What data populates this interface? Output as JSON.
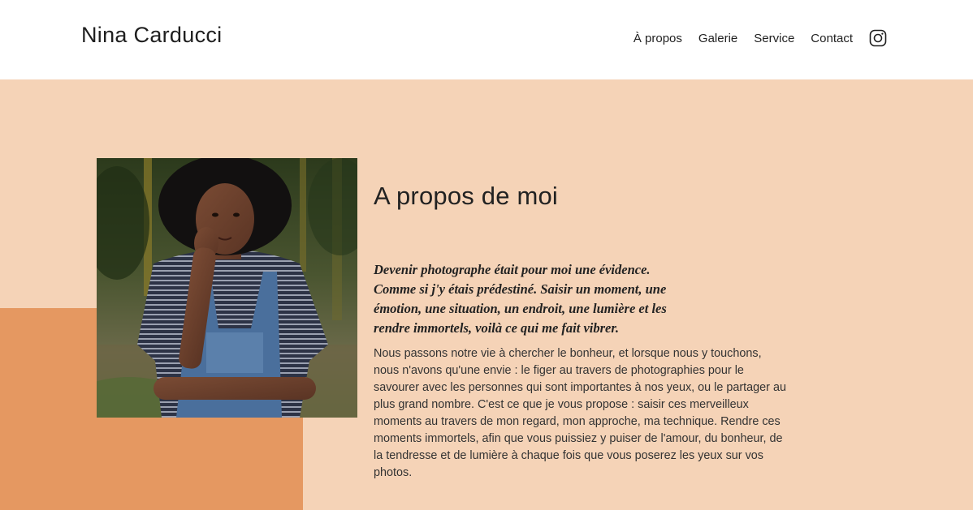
{
  "header": {
    "site_title": "Nina Carducci",
    "nav": [
      {
        "label": "À propos"
      },
      {
        "label": "Galerie"
      },
      {
        "label": "Service"
      },
      {
        "label": "Contact"
      }
    ],
    "social_icon": "instagram-icon"
  },
  "about": {
    "title": "A propos de moi",
    "lead": "Devenir photographe était pour moi une évidence. Comme si j'y étais prédestiné. Saisir un moment, une émotion, une situation, un endroit, une lumière et les rendre immortels, voilà ce qui me fait vibrer.",
    "body": "Nous passons notre vie à chercher le bonheur, et lorsque nous y touchons, nous n'avons qu'une envie : le figer au travers de photographies pour le savourer avec les personnes qui sont importantes à nos yeux, ou le partager au plus grand nombre. C'est ce que je vous propose : saisir ces merveilleux moments au travers de mon regard, mon approche, ma technique. Rendre ces moments immortels, afin que vous puissiez y puiser de l'amour, du bonheur, de la tendresse et de lumière à chaque fois que vous poserez les yeux sur vos photos."
  },
  "colors": {
    "hero_background": "#f5d3b7",
    "accent_block": "#e59861",
    "header_background": "#ffffff"
  }
}
